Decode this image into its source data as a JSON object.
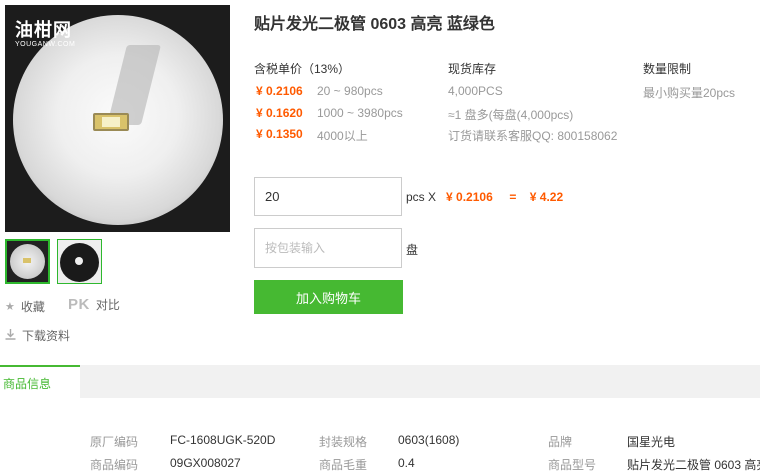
{
  "watermark": {
    "name": "油柑网",
    "domain": "YOUGANW.COM"
  },
  "actions": {
    "favorite": "收藏",
    "pk_badge": "PK",
    "compare": "对比",
    "download": "下载资料"
  },
  "product": {
    "title": "贴片发光二极管 0603 高亮 蓝绿色"
  },
  "pricing": {
    "header": "含税单价（13%）",
    "tiers": [
      {
        "price": "¥ 0.2106",
        "range": "20 ~ 980pcs"
      },
      {
        "price": "¥ 0.1620",
        "range": "1000 ~ 3980pcs"
      },
      {
        "price": "¥ 0.1350",
        "range": "4000以上"
      }
    ]
  },
  "stock": {
    "header": "现货库存",
    "quantity": "4,000PCS",
    "reel": "≈1 盘多(每盘(4,000pcs)",
    "order_note": "订货请联系客服QQ: 800158062"
  },
  "limit": {
    "header": "数量限制",
    "min": "最小购买量20pcs"
  },
  "order": {
    "qty_value": "20",
    "qty_unit": "pcs X",
    "unit_price": "¥ 0.2106",
    "equals": "=",
    "total": "¥ 4.22",
    "pkg_placeholder": "按包装输入",
    "pkg_unit": "盘",
    "add_to_cart": "加入购物车"
  },
  "tabs": {
    "info": "商品信息"
  },
  "specs": {
    "row1": {
      "k1": "原厂编码",
      "v1": "FC-1608UGK-520D",
      "k2": "封装规格",
      "v2": "0603(1608)",
      "k3": "品牌",
      "v3": "国星光电"
    },
    "row2": {
      "k1": "商品编码",
      "v1": "09GX008027",
      "k2": "商品毛重",
      "v2": "0.4",
      "k3": "商品型号",
      "v3": "贴片发光二极管 0603 高亮"
    }
  },
  "colors": {
    "accent_green": "#46b932",
    "price_orange": "#ff5a00"
  }
}
